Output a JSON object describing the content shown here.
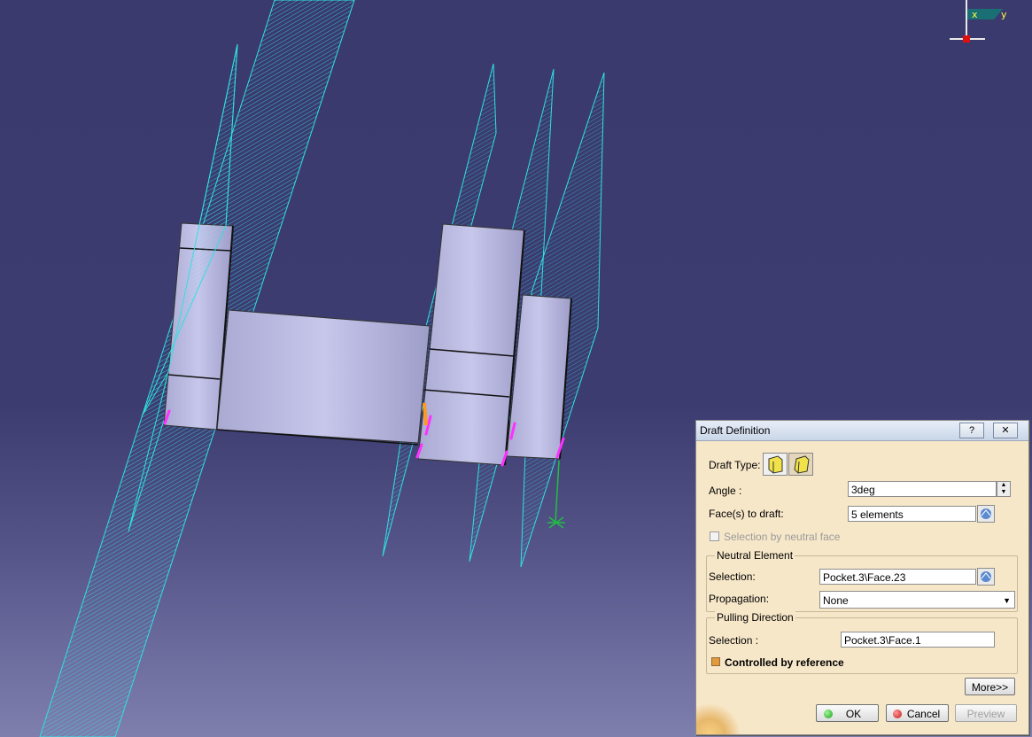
{
  "compass": {
    "x_label": "x",
    "y_label": "y"
  },
  "dialog": {
    "title": "Draft Definition",
    "help_button": "?",
    "close_button": "✕",
    "draft_type_label": "Draft Type:",
    "angle_label": "Angle :",
    "angle_value": "3deg",
    "faces_label": "Face(s) to draft:",
    "faces_value": "5 elements",
    "selection_by_neutral_face": "Selection by neutral face",
    "neutral_element": {
      "title": "Neutral Element",
      "selection_label": "Selection:",
      "selection_value": "Pocket.3\\Face.23",
      "propagation_label": "Propagation:",
      "propagation_value": "None"
    },
    "pulling_direction": {
      "title": "Pulling Direction",
      "selection_label": "Selection :",
      "selection_value": "Pocket.3\\Face.1",
      "controlled_by_reference": "Controlled by reference"
    },
    "more_button": "More>>",
    "ok_button": "OK",
    "cancel_button": "Cancel",
    "preview_button": "Preview"
  },
  "colors": {
    "background": "#3a3a6e",
    "plane_outline": "#30e0e0",
    "part": "#b8b8e0",
    "highlight": "#ff30ff",
    "dialog_bg": "#f7e7c9"
  }
}
